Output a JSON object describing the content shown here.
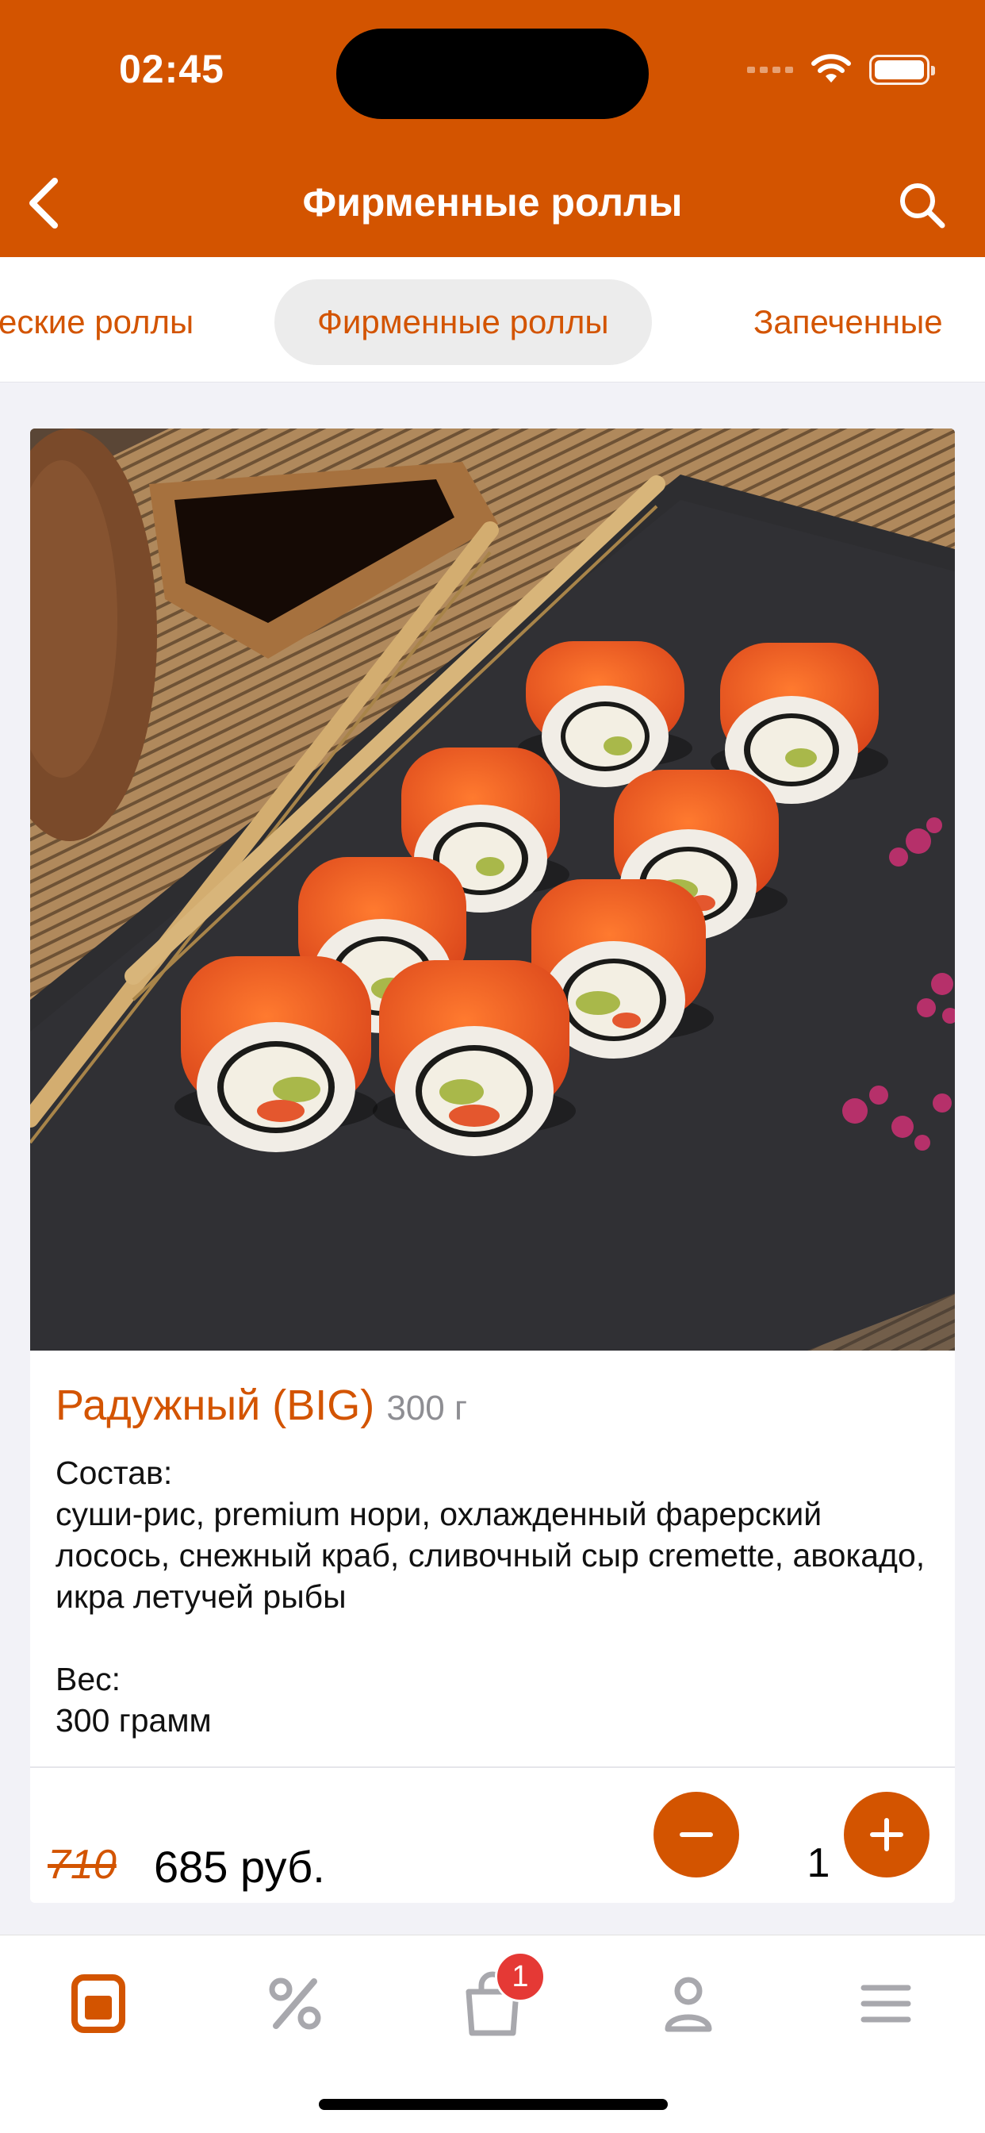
{
  "status_bar": {
    "time": "02:45"
  },
  "header": {
    "title": "Фирменные роллы",
    "back_icon": "chevron-left-icon",
    "search_icon": "search-icon"
  },
  "category_tabs": [
    {
      "label": "еские роллы",
      "active": false
    },
    {
      "label": "Фирменные роллы",
      "active": true
    },
    {
      "label": "Запеченные",
      "active": false
    }
  ],
  "product": {
    "name": "Радужный (BIG)",
    "weight": "300 г",
    "composition_label": "Состав:",
    "composition": "суши-рис, premium нори, охлажденный фарерский лосось, снежный краб, сливочный сыр cremette, авокадо, икра летучей рыбы",
    "weight_label": "Вес:",
    "weight_value": "300 грамм",
    "old_price": "710",
    "price": "685 руб.",
    "quantity": "1"
  },
  "tab_bar": {
    "items": [
      {
        "name": "menu",
        "icon": "menu-book-icon",
        "active": true
      },
      {
        "name": "promotions",
        "icon": "percent-icon",
        "active": false
      },
      {
        "name": "cart",
        "icon": "shopping-bag-icon",
        "active": false
      },
      {
        "name": "profile",
        "icon": "user-icon",
        "active": false
      },
      {
        "name": "more",
        "icon": "hamburger-icon",
        "active": false
      }
    ],
    "cart_badge": "1"
  },
  "colors": {
    "accent": "#d35400",
    "inactive": "#a8a8ad",
    "badge": "#e53935"
  }
}
